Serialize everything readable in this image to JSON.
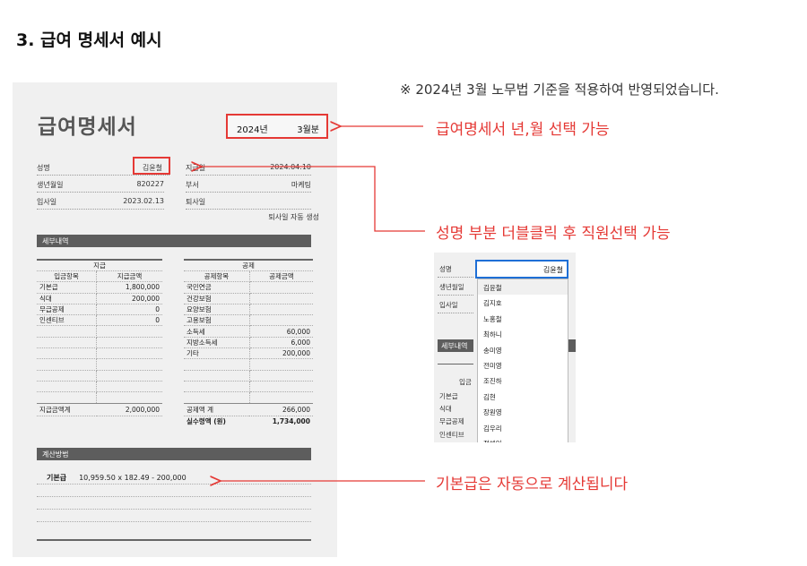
{
  "section_title": "3. 급여 명세서 예시",
  "note": "※ 2024년 3월 노무법 기준을 적용하여 반영되었습니다.",
  "slip": {
    "title": "급여명세서",
    "year": "2024년",
    "month": "3월분",
    "fields": {
      "name_label": "성명",
      "name": "김윤철",
      "pay_date_label": "지급일",
      "pay_date": "2024.04.10",
      "birth_label": "생년월일",
      "birth": "820227",
      "dept_label": "부서",
      "dept": "마케팅",
      "join_label": "입사일",
      "join": "2023.02.13",
      "retire_label": "퇴사일",
      "retire": ""
    },
    "retire_auto": "퇴사일 자동 생성",
    "detail_header": "세부내역",
    "pay": {
      "group": "지급",
      "col_item": "입금항목",
      "col_amount": "지급금액",
      "rows": [
        {
          "item": "기본급",
          "amount": "1,800,000"
        },
        {
          "item": "식대",
          "amount": "200,000"
        },
        {
          "item": "무급공제",
          "amount": "0"
        },
        {
          "item": "인센티브",
          "amount": "0"
        }
      ],
      "total_label": "지급금액계",
      "total": "2,000,000"
    },
    "deduct": {
      "group": "공제",
      "col_item": "공제항목",
      "col_amount": "공제금액",
      "rows": [
        {
          "item": "국민연금",
          "amount": ""
        },
        {
          "item": "건강보험",
          "amount": ""
        },
        {
          "item": "요양보험",
          "amount": ""
        },
        {
          "item": "고용보험",
          "amount": ""
        },
        {
          "item": "소득세",
          "amount": "60,000"
        },
        {
          "item": "지방소득세",
          "amount": "6,000"
        },
        {
          "item": "기타",
          "amount": "200,000"
        }
      ],
      "total_label": "공제액 계",
      "total": "266,000",
      "net_label": "실수령액 (원)",
      "net": "1,734,000"
    },
    "calc_header": "계산방법",
    "calc": {
      "label": "기본급",
      "formula": "10,959.50   x   182.49   -   200,000"
    }
  },
  "annotations": {
    "period": "급여명세서 년,월 선택 가능",
    "name": "성명 부분 더블클릭 후 직원선택 가능",
    "calc": "기본급은 자동으로 계산됩니다"
  },
  "inset": {
    "name_label": "성명",
    "selected": "김윤철",
    "birth_label": "생년월일",
    "join_label": "입사일",
    "detail_header": "세부내역",
    "row_labels": [
      "입금",
      "기본급",
      "식대",
      "무급공제",
      "인센티브"
    ],
    "options": [
      "김윤철",
      "김지호",
      "노홍철",
      "최하니",
      "송미영",
      "전미영",
      "조진하",
      "김현",
      "장원영",
      "김우리",
      "정해인"
    ]
  },
  "colors": {
    "annotation": "#e53935",
    "select_border": "#1e6fd6",
    "header_bar": "#5d5d5d"
  }
}
